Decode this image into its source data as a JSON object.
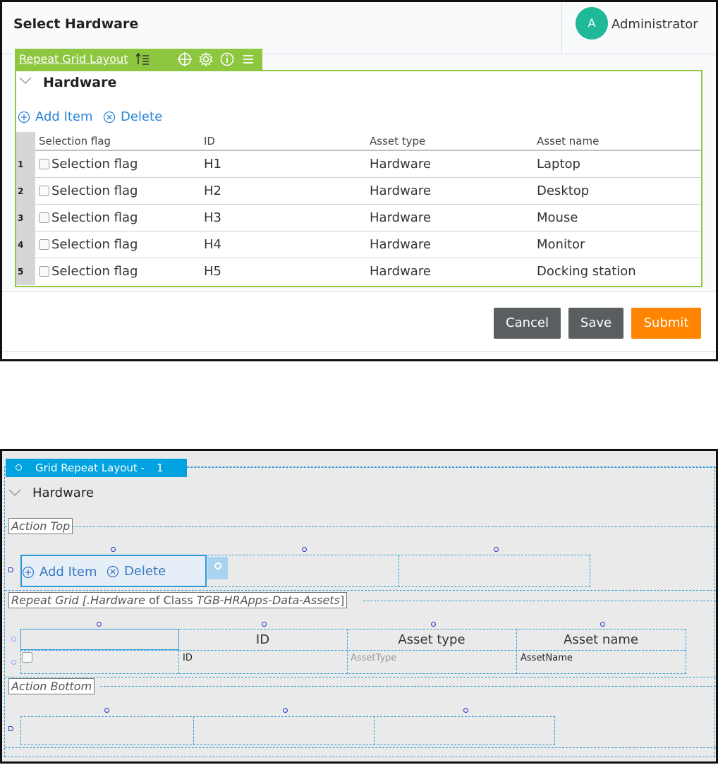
{
  "runtime": {
    "header": {
      "title": "Select Hardware",
      "avatar_initial": "A",
      "user_name": "Administrator"
    },
    "layout_toolbar": {
      "label": "Repeat Grid Layout",
      "icons": [
        "sort-rows-icon",
        "target-icon",
        "gear-icon",
        "info-icon",
        "menu-icon"
      ]
    },
    "section": {
      "title": "Hardware",
      "add_label": "Add Item",
      "delete_label": "Delete"
    },
    "grid": {
      "columns": [
        "Selection flag",
        "ID",
        "Asset type",
        "Asset name"
      ],
      "rows": [
        {
          "num": "1",
          "flag": "Selection flag",
          "id": "H1",
          "type": "Hardware",
          "name": "Laptop"
        },
        {
          "num": "2",
          "flag": "Selection flag",
          "id": "H2",
          "type": "Hardware",
          "name": "Desktop"
        },
        {
          "num": "3",
          "flag": "Selection flag",
          "id": "H3",
          "type": "Hardware",
          "name": "Mouse"
        },
        {
          "num": "4",
          "flag": "Selection flag",
          "id": "H4",
          "type": "Hardware",
          "name": "Monitor"
        },
        {
          "num": "5",
          "flag": "Selection flag",
          "id": "H5",
          "type": "Hardware",
          "name": "Docking station"
        }
      ]
    },
    "buttons": {
      "cancel": "Cancel",
      "save": "Save",
      "submit": "Submit"
    }
  },
  "designer": {
    "layout_tab": {
      "label": "Grid Repeat Layout -",
      "number": "1"
    },
    "section_title": "Hardware",
    "action_top_label": "Action Top",
    "add_label": "Add Item",
    "delete_label": "Delete",
    "repeat_grid_label": {
      "prefix": "Repeat Grid [",
      "property": ".Hardware",
      "middle": " of Class ",
      "class_name": "TGB-HRApps-Data-Assets",
      "suffix": "]"
    },
    "grid_headers": [
      "",
      "ID",
      "Asset type",
      "Asset name"
    ],
    "grid_properties": [
      "ID",
      "AssetType",
      "AssetName"
    ],
    "action_bottom_label": "Action Bottom"
  },
  "colors": {
    "layout_green": "#8dc63f",
    "link_blue": "#2a84d6",
    "avatar_teal": "#1fb999",
    "button_gray": "#5b5e61",
    "submit_orange": "#ff8500",
    "designer_blue": "#00a3e0"
  }
}
